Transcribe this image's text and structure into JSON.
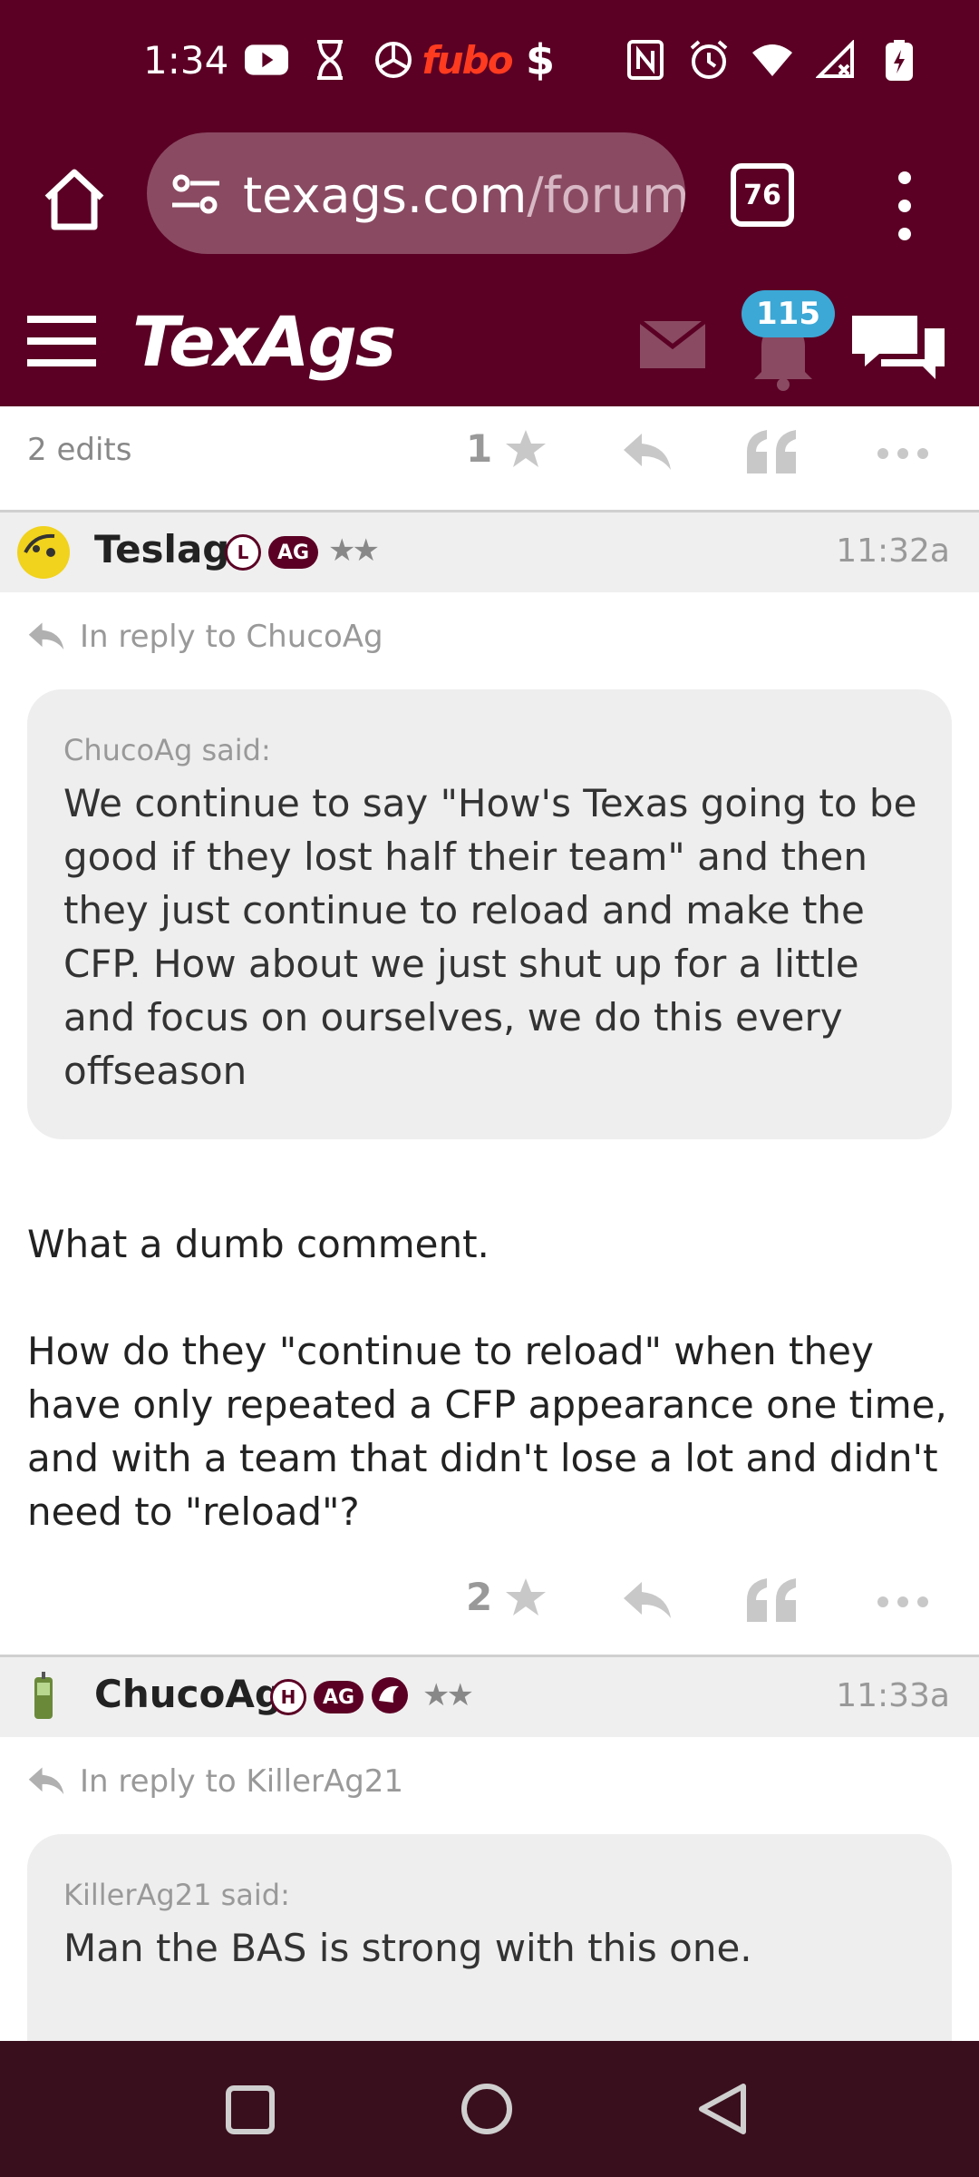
{
  "status_bar": {
    "time": "1:34",
    "left_icons": [
      "youtube-icon",
      "hourglass-icon",
      "openai-icon",
      "fubo-icon",
      "dollar-icon"
    ],
    "fubo_label": "fubo",
    "dollar_label": "$",
    "right_icons": [
      "nfc-icon",
      "alarm-icon",
      "wifi-icon",
      "signal-icon",
      "battery-charging-icon"
    ]
  },
  "browser": {
    "url_domain": "texags.com",
    "url_path": "/forum",
    "tab_count": "76"
  },
  "site_header": {
    "logo": "TexAgs",
    "notification_count": "115",
    "colors": {
      "brand": "#5b0024",
      "badge": "#3ca8d6"
    }
  },
  "posts": [
    {
      "edits": "2 edits",
      "star_count": "1"
    },
    {
      "username": "Teslag",
      "tags": [
        "L",
        "AG"
      ],
      "rank": "★★",
      "time": "11:32a",
      "reply_to": "In reply to ChucoAg",
      "quote_author": "ChucoAg said:",
      "quote_text": "We continue to say \"How's Texas going to be good if they lost half their team\" and then they just continue to reload and make the CFP. How about we just shut up for a little and focus on ourselves, we do this every offseason",
      "body_p1": "What a dumb comment.",
      "body_p2": "How do they \"continue to reload\" when they have only repeated a CFP appearance one time, and with a team that didn't lose a lot and didn't need to \"reload\"?",
      "star_count": "2"
    },
    {
      "username": "ChucoAg",
      "tags": [
        "H",
        "AG"
      ],
      "rank": "★★",
      "time": "11:33a",
      "reply_to": "In reply to KillerAg21",
      "quote_author": "KillerAg21 said:",
      "quote_text": "Man the BAS is strong with this one."
    }
  ]
}
